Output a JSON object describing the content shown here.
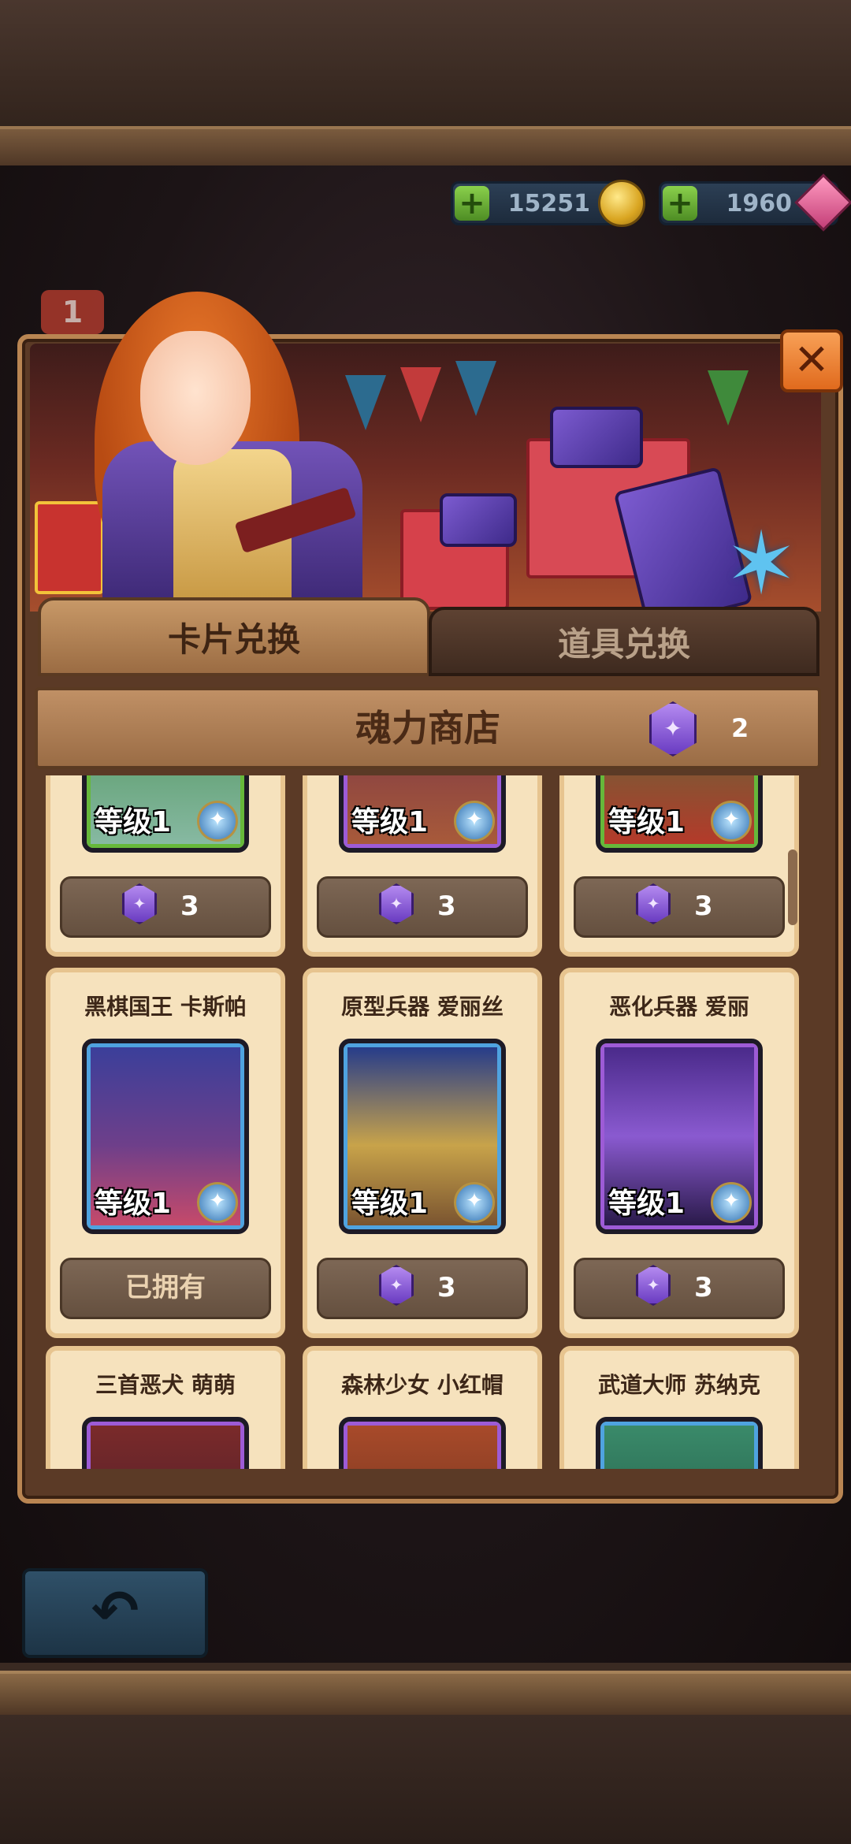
{
  "currency": {
    "gold": "15251",
    "gems": "1960"
  },
  "background_badge": "1",
  "tabs": [
    {
      "label": "卡片兑换",
      "active": true
    },
    {
      "label": "道具兑换",
      "active": false
    }
  ],
  "shop": {
    "title": "魂力商店",
    "soul_count": "2"
  },
  "items": [
    {
      "name": "",
      "level": "等级1",
      "price": "3",
      "owned": false,
      "frame": "green"
    },
    {
      "name": "",
      "level": "等级1",
      "price": "3",
      "owned": false,
      "frame": "purple"
    },
    {
      "name": "",
      "level": "等级1",
      "price": "3",
      "owned": false,
      "frame": "green"
    },
    {
      "name": "黑棋国王 卡斯帕",
      "level": "等级1",
      "price": "已拥有",
      "owned": true,
      "frame": "blue"
    },
    {
      "name": "原型兵器 爱丽丝",
      "level": "等级1",
      "price": "3",
      "owned": false,
      "frame": "blue"
    },
    {
      "name": "恶化兵器 爱丽",
      "level": "等级1",
      "price": "3",
      "owned": false,
      "frame": "purple"
    },
    {
      "name": "三首恶犬 萌萌",
      "level": "",
      "price": "",
      "owned": false,
      "frame": "purple"
    },
    {
      "name": "森林少女 小红帽",
      "level": "",
      "price": "",
      "owned": false,
      "frame": "purple"
    },
    {
      "name": "武道大师 苏纳克",
      "level": "",
      "price": "",
      "owned": false,
      "frame": "blue"
    }
  ],
  "icons": {
    "close": "close-icon",
    "back": "back-arrow-icon",
    "soul": "soul-gem-icon",
    "gold": "gold-coin-icon",
    "gem": "gem-icon",
    "add": "plus-icon"
  },
  "colors": {
    "panel": "#5b3a26",
    "accent_orange": "#e06a1d",
    "tab_active": "#c79867",
    "cell_bg": "#f6e2bd",
    "price_bg": "#6f5948"
  }
}
